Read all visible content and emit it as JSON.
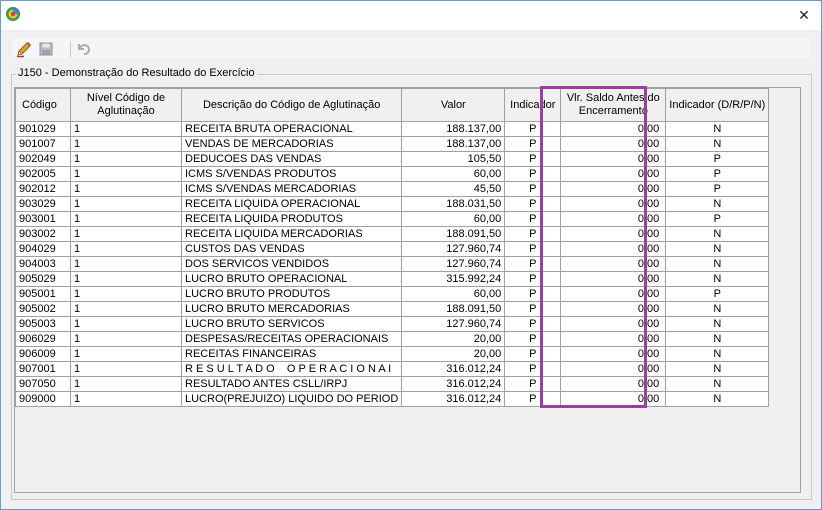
{
  "titlebar": {
    "close_glyph": "✕"
  },
  "toolbar": {
    "edit_icon": "pencil-icon",
    "save_icon": "floppy-disk-icon",
    "undo_icon": "undo-icon"
  },
  "group": {
    "title": "J150 - Demonstração do Resultado do Exercício"
  },
  "table": {
    "headers": {
      "codigo": "Código",
      "nivel": "Nível Código de Aglutinação",
      "descricao": "Descrição do Código de Aglutinação",
      "valor": "Valor",
      "indicador": "Indicador",
      "vlr_saldo": "Vlr. Saldo Antes do Encerramento",
      "indicador_drpn": "Indicador (D/R/P/N)"
    },
    "rows": [
      {
        "codigo": "901029",
        "nivel": "1",
        "descricao": "RECEITA BRUTA OPERACIONAL",
        "valor": "188.137,00",
        "indicador": "P",
        "vlr_saldo": "0,00",
        "ind2": "N"
      },
      {
        "codigo": "901007",
        "nivel": "1",
        "descricao": "VENDAS DE MERCADORIAS",
        "valor": "188.137,00",
        "indicador": "P",
        "vlr_saldo": "0,00",
        "ind2": "N"
      },
      {
        "codigo": "902049",
        "nivel": "1",
        "descricao": "DEDUCOES DAS VENDAS",
        "valor": "105,50",
        "indicador": "P",
        "vlr_saldo": "0,00",
        "ind2": "P"
      },
      {
        "codigo": "902005",
        "nivel": "1",
        "descricao": "ICMS S/VENDAS PRODUTOS",
        "valor": "60,00",
        "indicador": "P",
        "vlr_saldo": "0,00",
        "ind2": "P"
      },
      {
        "codigo": "902012",
        "nivel": "1",
        "descricao": "ICMS S/VENDAS MERCADORIAS",
        "valor": "45,50",
        "indicador": "P",
        "vlr_saldo": "0,00",
        "ind2": "P"
      },
      {
        "codigo": "903029",
        "nivel": "1",
        "descricao": "RECEITA LIQUIDA OPERACIONAL",
        "valor": "188.031,50",
        "indicador": "P",
        "vlr_saldo": "0,00",
        "ind2": "N"
      },
      {
        "codigo": "903001",
        "nivel": "1",
        "descricao": "RECEITA LIQUIDA PRODUTOS",
        "valor": "60,00",
        "indicador": "P",
        "vlr_saldo": "0,00",
        "ind2": "P"
      },
      {
        "codigo": "903002",
        "nivel": "1",
        "descricao": "RECEITA LIQUIDA MERCADORIAS",
        "valor": "188.091,50",
        "indicador": "P",
        "vlr_saldo": "0,00",
        "ind2": "N"
      },
      {
        "codigo": "904029",
        "nivel": "1",
        "descricao": "CUSTOS DAS VENDAS",
        "valor": "127.960,74",
        "indicador": "P",
        "vlr_saldo": "0,00",
        "ind2": "N"
      },
      {
        "codigo": "904003",
        "nivel": "1",
        "descricao": "DOS SERVICOS VENDIDOS",
        "valor": "127.960,74",
        "indicador": "P",
        "vlr_saldo": "0,00",
        "ind2": "N"
      },
      {
        "codigo": "905029",
        "nivel": "1",
        "descricao": "LUCRO BRUTO OPERACIONAL",
        "valor": "315.992,24",
        "indicador": "P",
        "vlr_saldo": "0,00",
        "ind2": "N"
      },
      {
        "codigo": "905001",
        "nivel": "1",
        "descricao": "LUCRO BRUTO PRODUTOS",
        "valor": "60,00",
        "indicador": "P",
        "vlr_saldo": "0,00",
        "ind2": "P"
      },
      {
        "codigo": "905002",
        "nivel": "1",
        "descricao": "LUCRO BRUTO MERCADORIAS",
        "valor": "188.091,50",
        "indicador": "P",
        "vlr_saldo": "0,00",
        "ind2": "N"
      },
      {
        "codigo": "905003",
        "nivel": "1",
        "descricao": "LUCRO BRUTO SERVICOS",
        "valor": "127.960,74",
        "indicador": "P",
        "vlr_saldo": "0,00",
        "ind2": "N"
      },
      {
        "codigo": "906029",
        "nivel": "1",
        "descricao": "DESPESAS/RECEITAS OPERACIONAIS",
        "valor": "20,00",
        "indicador": "P",
        "vlr_saldo": "0,00",
        "ind2": "N"
      },
      {
        "codigo": "906009",
        "nivel": "1",
        "descricao": "RECEITAS FINANCEIRAS",
        "valor": "20,00",
        "indicador": "P",
        "vlr_saldo": "0,00",
        "ind2": "N"
      },
      {
        "codigo": "907001",
        "nivel": "1",
        "descricao": "R E S U L T A D O    O P E R A C I O N A I",
        "valor": "316.012,24",
        "indicador": "P",
        "vlr_saldo": "0,00",
        "ind2": "N"
      },
      {
        "codigo": "907050",
        "nivel": "1",
        "descricao": "RESULTADO ANTES CSLL/IRPJ",
        "valor": "316.012,24",
        "indicador": "P",
        "vlr_saldo": "0,00",
        "ind2": "N"
      },
      {
        "codigo": "909000",
        "nivel": "1",
        "descricao": "LUCRO(PREJUIZO) LIQUIDO DO PERIOD",
        "valor": "316.012,24",
        "indicador": "P",
        "vlr_saldo": "0,00",
        "ind2": "N"
      }
    ]
  },
  "colors": {
    "highlight": "#9b3ea1"
  }
}
